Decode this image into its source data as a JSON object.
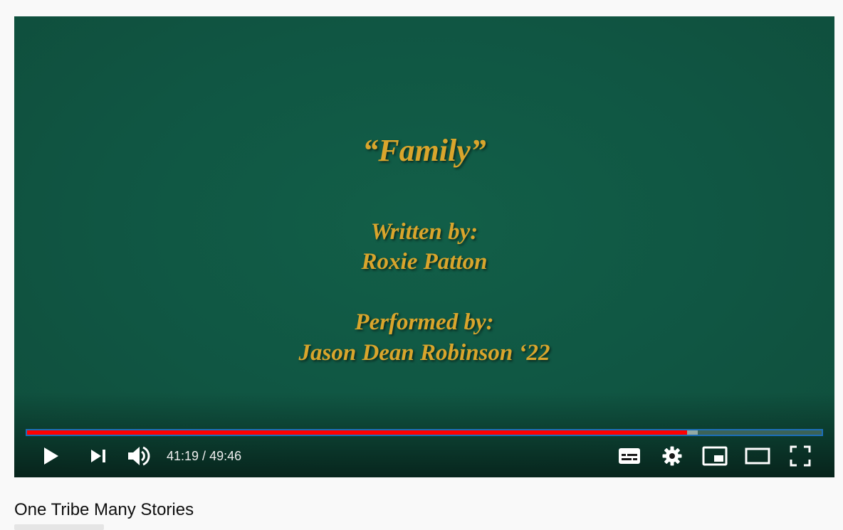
{
  "video": {
    "credits": {
      "song_title": "“Family”",
      "written_label": "Written by:",
      "written_name": "Roxie Patton",
      "performed_label": "Performed by:",
      "performed_name": "Jason Dean Robinson ‘22"
    },
    "progress": {
      "played_fraction": 0.8305,
      "buffered_fraction": 0.8439
    },
    "time": {
      "current": "41:19",
      "separator": " / ",
      "duration": "49:46"
    },
    "controls": {
      "play": "play-icon",
      "next": "next-icon",
      "volume": "volume-icon",
      "subtitles": "subtitles-icon",
      "settings": "gear-icon",
      "miniplayer": "miniplayer-icon",
      "theater": "theater-mode-icon",
      "fullscreen": "fullscreen-icon"
    },
    "colors": {
      "frame_background": "#105540",
      "credit_text": "#d9a52c",
      "progress_played": "#ff0000",
      "progress_focus_outline": "#1d6fb8"
    }
  },
  "channel": {
    "title": "One Tribe Many Stories"
  }
}
